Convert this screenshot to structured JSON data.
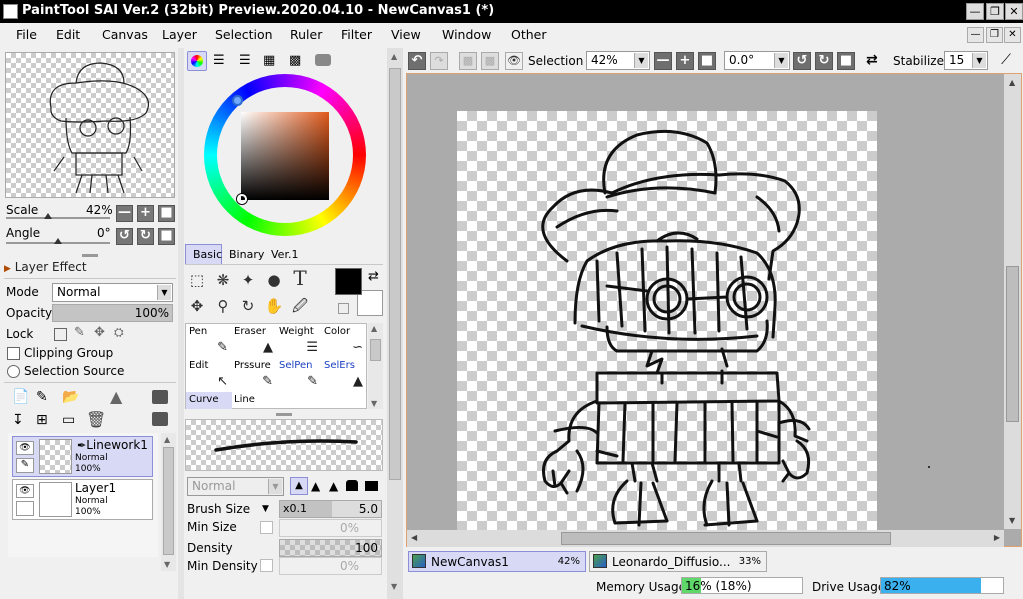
{
  "window": {
    "title": "PaintTool SAI Ver.2 (32bit) Preview.2020.04.10 - NewCanvas1 (*)",
    "controls": [
      "minimize-icon",
      "restore-icon",
      "close-icon"
    ]
  },
  "menubar": {
    "items": [
      "File",
      "Edit",
      "Canvas",
      "Layer",
      "Selection",
      "Ruler",
      "Filter",
      "View",
      "Window",
      "Other"
    ]
  },
  "navigator": {
    "scale_label": "Scale",
    "scale_value": "42%",
    "angle_label": "Angle",
    "angle_value": "0°"
  },
  "layer_effect": {
    "header": "Layer Effect",
    "mode_label": "Mode",
    "mode_value": "Normal",
    "opacity_label": "Opacity",
    "opacity_value": "100%",
    "opacity_fraction": 1.0,
    "lock_label": "Lock",
    "clipping_group_label": "Clipping Group",
    "selection_source_label": "Selection Source"
  },
  "layers": [
    {
      "name": "Linework1",
      "mode": "Normal",
      "opacity": "100%",
      "selected": true
    },
    {
      "name": "Layer1",
      "mode": "Normal",
      "opacity": "100%",
      "selected": false
    }
  ],
  "color_tabs": [
    "Basic",
    "Binary",
    "Ver.1"
  ],
  "colors": {
    "primary": "#000000",
    "secondary": "#ffffff",
    "accent": "#4a6fd6",
    "selection_bar": "#d7d9f5"
  },
  "brush_tools": [
    {
      "label": "Pen",
      "icon": "pen-icon"
    },
    {
      "label": "Eraser",
      "icon": "eraser-icon"
    },
    {
      "label": "Weight",
      "icon": "weight-icon"
    },
    {
      "label": "Color",
      "icon": "color-icon"
    },
    {
      "label": "Edit",
      "icon": "edit-icon"
    },
    {
      "label": "Prssure",
      "icon": "pressure-icon"
    },
    {
      "label": "SelPen",
      "icon": "selpen-icon"
    },
    {
      "label": "SelErs",
      "icon": "selers-icon"
    },
    {
      "label": "Curve",
      "icon": "curve-icon"
    },
    {
      "label": "Line",
      "icon": "line-icon"
    }
  ],
  "brush_settings": {
    "blend_mode": "Normal",
    "brush_size_label": "Brush Size",
    "brush_size_multiplier": "x0.1",
    "brush_size_value": "5.0",
    "min_size_label": "Min Size",
    "min_size_value": "0%",
    "density_label": "Density",
    "density_value": "100",
    "min_density_label": "Min Density",
    "min_density_value": "0%"
  },
  "canvas_toolbar": {
    "selection_label": "Selection",
    "zoom_value": "42%",
    "rotation_value": "0.0°",
    "stabilizer_label": "Stabilizer",
    "stabilizer_value": "15"
  },
  "doc_tabs": [
    {
      "name": "NewCanvas1",
      "zoom": "42%",
      "active": true
    },
    {
      "name": "Leonardo_Diffusio...",
      "zoom": "33%",
      "active": false
    }
  ],
  "status": {
    "memory_label": "Memory Usage",
    "memory_value": "16% (18%)",
    "memory_fraction": 0.16,
    "drive_label": "Drive Usage",
    "drive_value": "82%",
    "drive_fraction": 0.82
  }
}
